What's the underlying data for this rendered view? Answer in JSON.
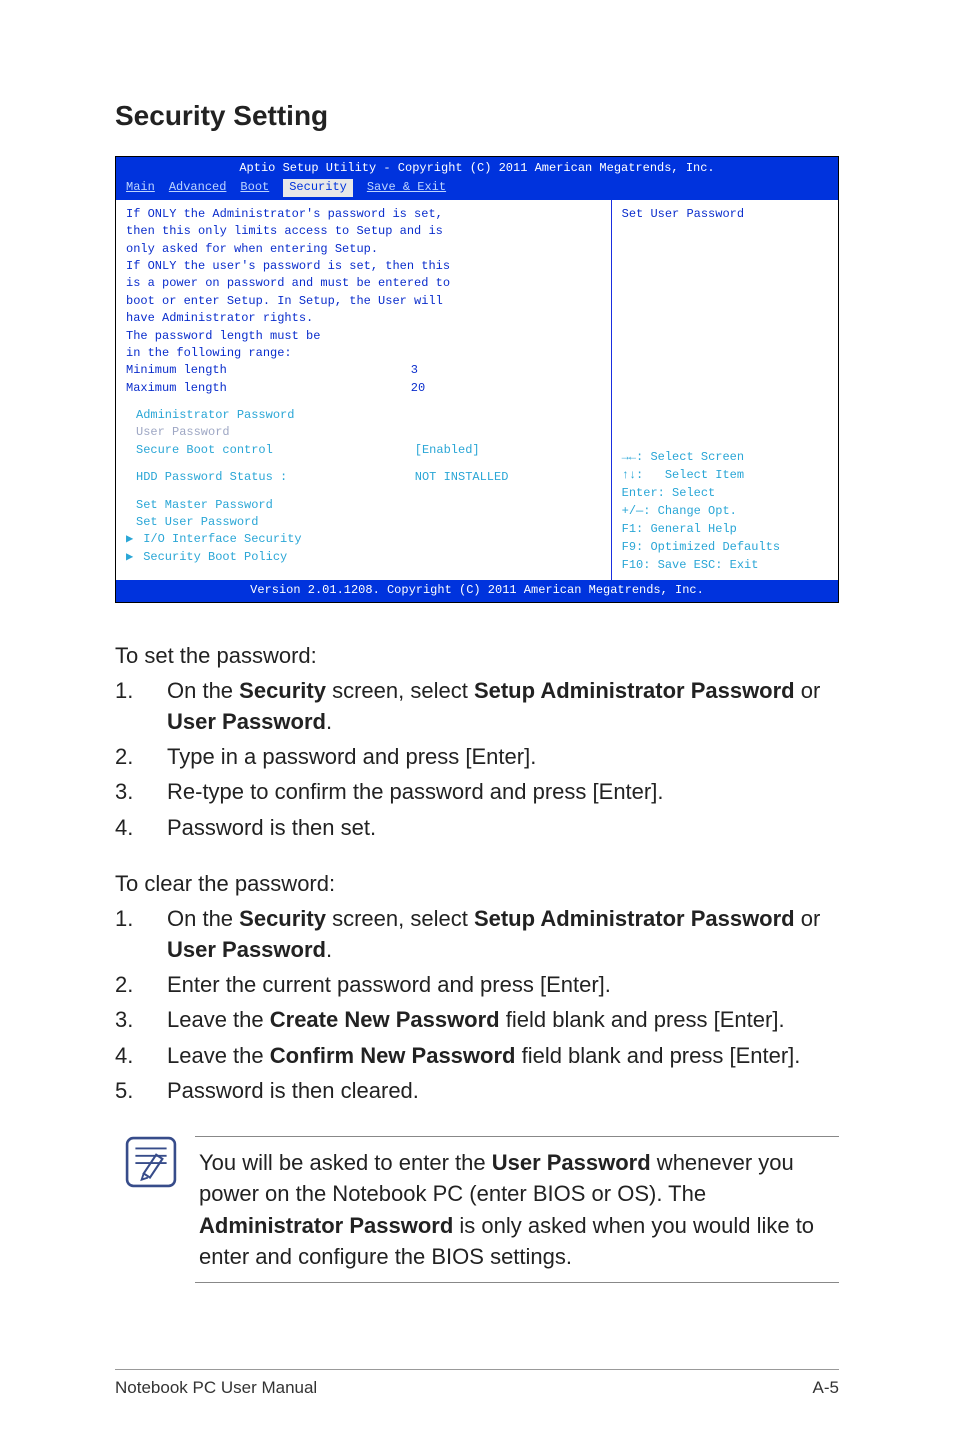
{
  "title": "Security Setting",
  "bios": {
    "header": "Aptio Setup Utility - Copyright (C) 2011 American Megatrends, Inc.",
    "tabs": [
      "Main",
      "Advanced",
      "Boot",
      "Security",
      "Save & Exit"
    ],
    "active_tab": "Security",
    "desc_lines": [
      "If ONLY the Administrator's password is set,",
      "then this only limits access to Setup and is",
      "only asked for when entering Setup.",
      "If ONLY the user's password is set, then this",
      "is a power on password and must be entered to",
      "boot or enter Setup. In Setup, the User will",
      "have Administrator rights.",
      "The password length must be",
      "in the following range:"
    ],
    "min_label": "Minimum length",
    "min_value": "3",
    "max_label": "Maximum length",
    "max_value": "20",
    "menu": {
      "admin_pw": "Administrator Password",
      "user_pw": "User Password",
      "secure_boot_ctrl_label": "Secure Boot control",
      "secure_boot_ctrl_value": "[Enabled]",
      "hdd_status_label": "HDD Password Status :",
      "hdd_status_value": "NOT INSTALLED",
      "set_master": "Set Master Password",
      "set_user": "Set User Password",
      "io_interface": "I/O Interface Security",
      "sec_boot_policy": "Security Boot Policy"
    },
    "right_title": "Set User Password",
    "hints": {
      "select_screen": "Select Screen",
      "select_item": "Select Item",
      "enter": "Enter: Select",
      "change_opt": "+/—:  Change Opt.",
      "f1": "F1:    General Help",
      "f9": "F9:    Optimized Defaults",
      "f10": "F10:  Save    ESC:  Exit"
    },
    "footer": "Version 2.01.1208. Copyright (C) 2011 American Megatrends, Inc."
  },
  "set_pw_intro": "To set the password:",
  "set_pw_steps": {
    "s1a": "On the ",
    "s1b": "Security",
    "s1c": " screen, select ",
    "s1d": "Setup Administrator Password",
    "s1e": " or ",
    "s1f": "User Password",
    "s1g": ".",
    "s2": "Type in a password and press [Enter].",
    "s3": "Re-type to confirm the password and press [Enter].",
    "s4": "Password is then set."
  },
  "clear_pw_intro": "To clear the password:",
  "clear_pw_steps": {
    "c1a": "On the ",
    "c1b": "Security",
    "c1c": " screen, select ",
    "c1d": "Setup Administrator Password",
    "c1e": " or ",
    "c1f": "User Password",
    "c1g": ".",
    "c2": "Enter the current password and press [Enter].",
    "c3a": "Leave the ",
    "c3b": "Create New Password",
    "c3c": " field blank and press [Enter].",
    "c4a": "Leave the ",
    "c4b": "Confirm New Password",
    "c4c": " field blank and press [Enter].",
    "c5": "Password is then cleared."
  },
  "note": {
    "a": "You will be asked to enter the ",
    "b": "User Password",
    "c": " whenever you power on the Notebook PC (enter BIOS or OS). The ",
    "d": "Administrator Password",
    "e": " is only asked when you would like to enter and configure the BIOS settings."
  },
  "footer_left": "Notebook PC User Manual",
  "footer_right": "A-5"
}
